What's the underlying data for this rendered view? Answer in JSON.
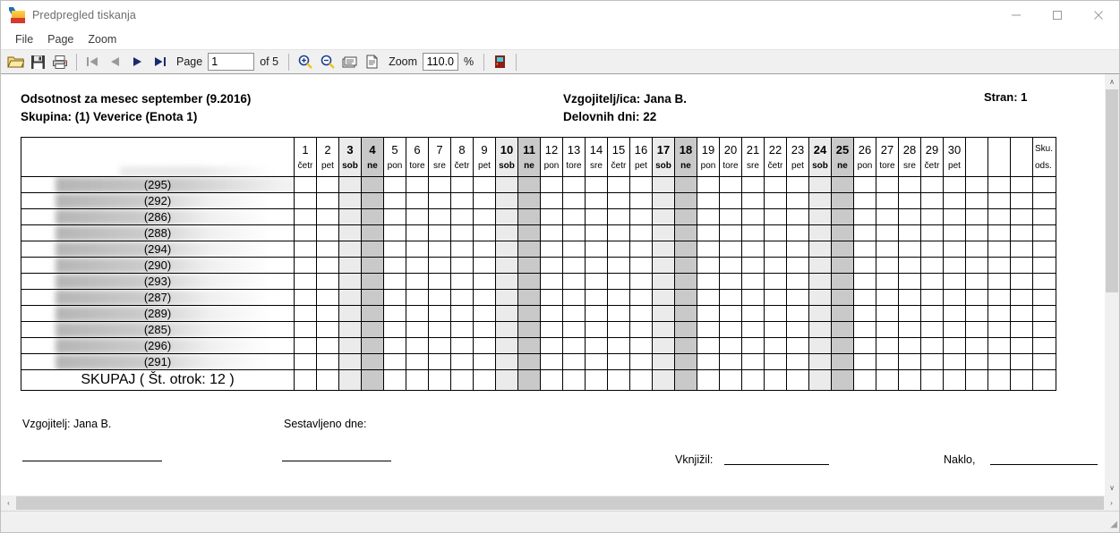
{
  "window": {
    "title": "Predpregled tiskanja",
    "icon": "app-logo-icon",
    "minimize": "–",
    "maximize": "□",
    "close": "✕"
  },
  "menubar": {
    "items": [
      {
        "label": "File"
      },
      {
        "label": "Page"
      },
      {
        "label": "Zoom"
      }
    ]
  },
  "toolbar": {
    "open_icon": "open-folder-icon",
    "save_icon": "save-disk-icon",
    "print_icon": "printer-icon",
    "first_icon": "first-page-icon",
    "prev_icon": "previous-page-icon",
    "next_icon": "next-page-icon",
    "last_icon": "last-page-icon",
    "page_label": "Page",
    "page_value": "1",
    "of_label": "of 5",
    "zoom_in_icon": "zoom-in-icon",
    "zoom_out_icon": "zoom-out-icon",
    "fit_width_icon": "fit-width-icon",
    "fit_page_icon": "fit-page-icon",
    "zoom_label": "Zoom",
    "zoom_value": "110.0",
    "percent_label": "%",
    "exit_icon": "exit-door-icon"
  },
  "document": {
    "title_line1": "Odsotnost za mesec september (9.2016)",
    "title_line2": "Skupina: (1) Veverice (Enota 1)",
    "teacher_line": "Vzgojitelj/ica: Jana B.",
    "workdays_line": "Delovnih dni: 22",
    "page_label": "Stran: 1",
    "table": {
      "name_header": "",
      "summary_header_top": "Sku.",
      "summary_header_bottom": "ods.",
      "blank_columns": 3,
      "days": [
        {
          "num": "1",
          "dow": "četr",
          "type": "weekday"
        },
        {
          "num": "2",
          "dow": "pet",
          "type": "weekday"
        },
        {
          "num": "3",
          "dow": "sob",
          "type": "saturday"
        },
        {
          "num": "4",
          "dow": "ne",
          "type": "sunday"
        },
        {
          "num": "5",
          "dow": "pon",
          "type": "weekday"
        },
        {
          "num": "6",
          "dow": "tore",
          "type": "weekday"
        },
        {
          "num": "7",
          "dow": "sre",
          "type": "weekday"
        },
        {
          "num": "8",
          "dow": "četr",
          "type": "weekday"
        },
        {
          "num": "9",
          "dow": "pet",
          "type": "weekday"
        },
        {
          "num": "10",
          "dow": "sob",
          "type": "saturday"
        },
        {
          "num": "11",
          "dow": "ne",
          "type": "sunday"
        },
        {
          "num": "12",
          "dow": "pon",
          "type": "weekday"
        },
        {
          "num": "13",
          "dow": "tore",
          "type": "weekday"
        },
        {
          "num": "14",
          "dow": "sre",
          "type": "weekday"
        },
        {
          "num": "15",
          "dow": "četr",
          "type": "weekday"
        },
        {
          "num": "16",
          "dow": "pet",
          "type": "weekday"
        },
        {
          "num": "17",
          "dow": "sob",
          "type": "saturday"
        },
        {
          "num": "18",
          "dow": "ne",
          "type": "sunday"
        },
        {
          "num": "19",
          "dow": "pon",
          "type": "weekday"
        },
        {
          "num": "20",
          "dow": "tore",
          "type": "weekday"
        },
        {
          "num": "21",
          "dow": "sre",
          "type": "weekday"
        },
        {
          "num": "22",
          "dow": "četr",
          "type": "weekday"
        },
        {
          "num": "23",
          "dow": "pet",
          "type": "weekday"
        },
        {
          "num": "24",
          "dow": "sob",
          "type": "saturday"
        },
        {
          "num": "25",
          "dow": "ne",
          "type": "sunday"
        },
        {
          "num": "26",
          "dow": "pon",
          "type": "weekday"
        },
        {
          "num": "27",
          "dow": "tore",
          "type": "weekday"
        },
        {
          "num": "28",
          "dow": "sre",
          "type": "weekday"
        },
        {
          "num": "29",
          "dow": "četr",
          "type": "weekday"
        },
        {
          "num": "30",
          "dow": "pet",
          "type": "weekday"
        }
      ],
      "rows": [
        {
          "id": "(295)",
          "name": "",
          "blur_width": 345
        },
        {
          "id": "(292)",
          "name": "",
          "blur_width": 240
        },
        {
          "id": "(286)",
          "name": "",
          "blur_width": 240
        },
        {
          "id": "(288)",
          "name": "",
          "blur_width": 240
        },
        {
          "id": "(294)",
          "name": "",
          "blur_width": 240
        },
        {
          "id": "(290)",
          "name": "",
          "blur_width": 240
        },
        {
          "id": "(293)",
          "name": "",
          "blur_width": 240
        },
        {
          "id": "(287)",
          "name": "",
          "blur_width": 240
        },
        {
          "id": "(289)",
          "name": "",
          "blur_width": 240
        },
        {
          "id": "(285)",
          "name": "",
          "blur_width": 240
        },
        {
          "id": "(296)",
          "name": "",
          "blur_width": 240
        },
        {
          "id": "(291)",
          "name": "",
          "blur_width": 240
        }
      ],
      "total_label": "SKUPAJ ( Št. otrok: 12 )"
    },
    "footer": {
      "teacher_signature_label": "Vzgojitelj: Jana B.",
      "compiled_label": "Sestavljeno dne:",
      "booked_label": "Vknjižil:",
      "place_label": "Naklo,"
    }
  },
  "scrollbars": {
    "up_arrow": "∧",
    "down_arrow": "∨",
    "left_arrow": "‹",
    "right_arrow": "›"
  },
  "colors": {
    "saturday": "#ebebeb",
    "sunday": "#c9c9c9",
    "toolbar_bg": "#f0f0f0",
    "title_text": "#6d6d6d"
  }
}
